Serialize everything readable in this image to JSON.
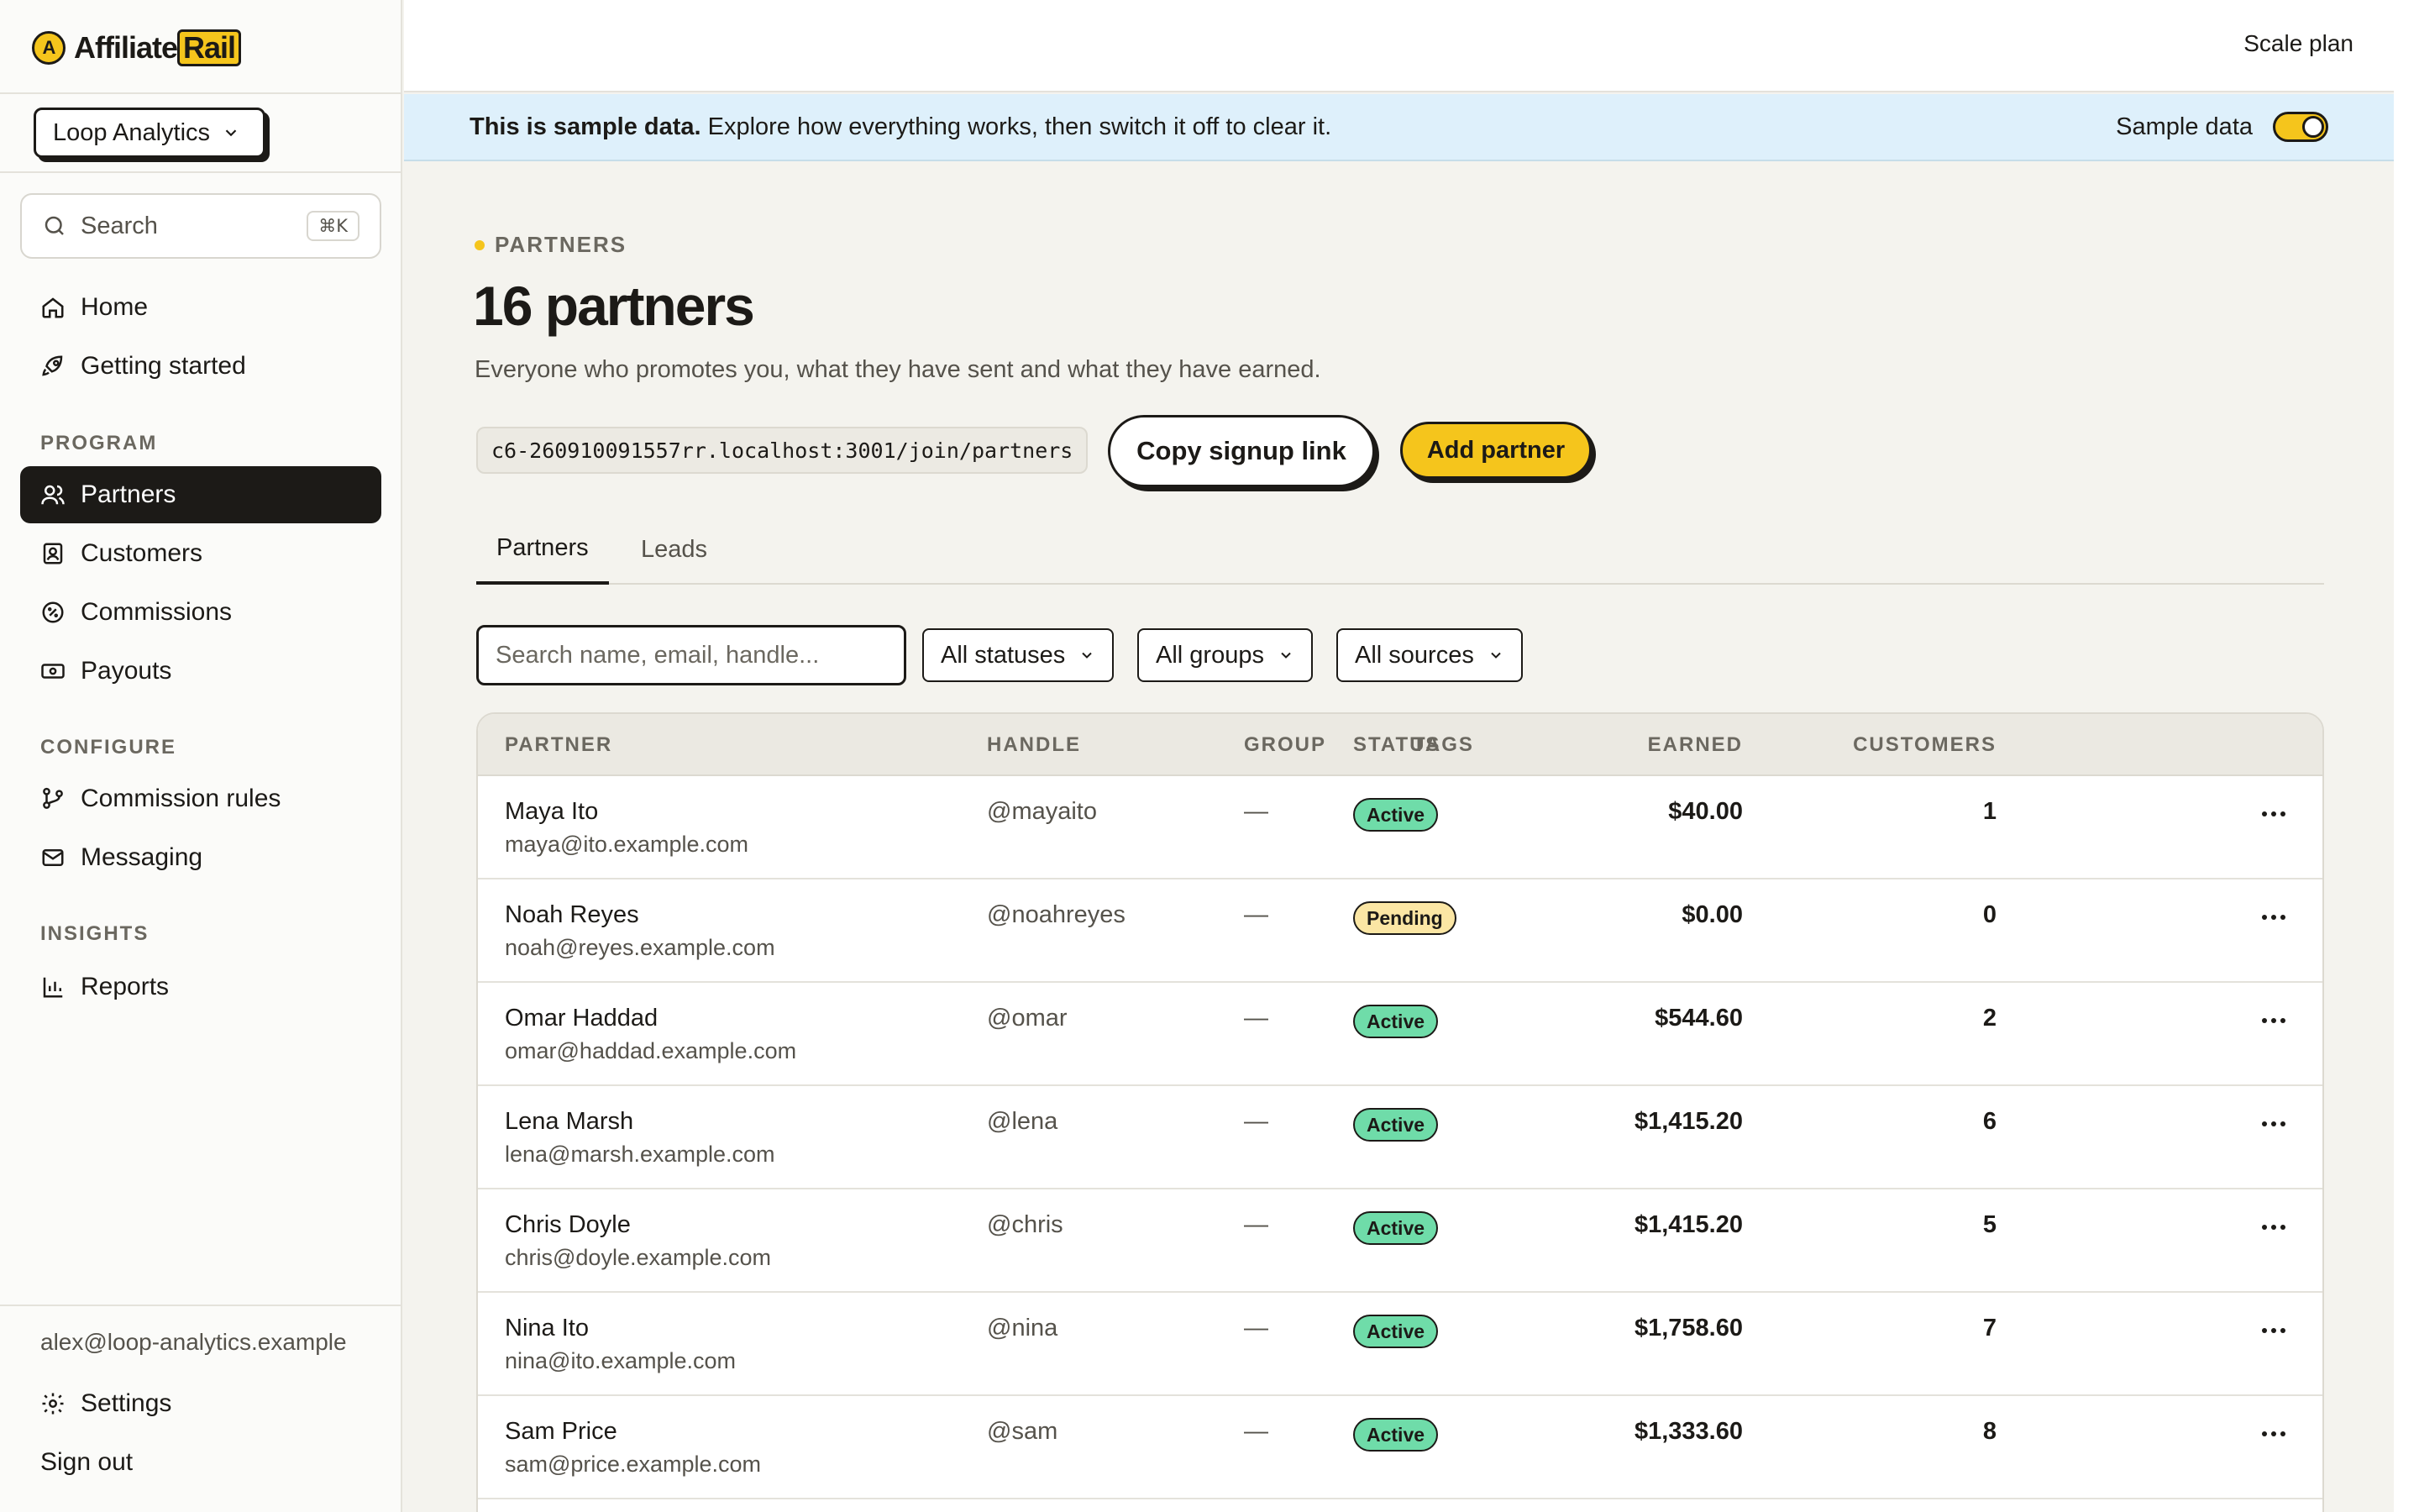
{
  "app": {
    "logo_mark": "A",
    "logo_text_1": "Affiliate",
    "logo_text_2": "Rail",
    "plan": "Scale plan"
  },
  "sidebar": {
    "org_name": "Loop Analytics",
    "search_label": "Search",
    "search_shortcut": "⌘K",
    "nav_main": [
      {
        "label": "Home",
        "icon": "home-icon"
      },
      {
        "label": "Getting started",
        "icon": "rocket-icon"
      }
    ],
    "section_program": "PROGRAM",
    "nav_program": [
      {
        "label": "Partners",
        "icon": "users-icon",
        "active": true
      },
      {
        "label": "Customers",
        "icon": "contact-icon"
      },
      {
        "label": "Commissions",
        "icon": "percent-badge-icon"
      },
      {
        "label": "Payouts",
        "icon": "banknote-icon"
      }
    ],
    "section_configure": "CONFIGURE",
    "nav_configure": [
      {
        "label": "Commission rules",
        "icon": "git-branch-icon"
      },
      {
        "label": "Messaging",
        "icon": "mail-icon"
      }
    ],
    "section_insights": "INSIGHTS",
    "nav_insights": [
      {
        "label": "Reports",
        "icon": "bar-chart-icon"
      }
    ],
    "user_email": "alex@loop-analytics.example",
    "settings_label": "Settings",
    "signout_label": "Sign out"
  },
  "banner": {
    "bold": "This is sample data.",
    "text": "Explore how everything works, then switch it off to clear it.",
    "toggle_label": "Sample data",
    "toggle_on": true
  },
  "page": {
    "eyebrow": "PARTNERS",
    "title": "16 partners",
    "subtitle": "Everyone who promotes you, what they have sent and what they have earned.",
    "signup_link": "c6-260910091557rr.localhost:3001/join/partners",
    "copy_button": "Copy signup link",
    "add_button": "Add partner"
  },
  "tabs": [
    {
      "label": "Partners",
      "active": true
    },
    {
      "label": "Leads",
      "active": false
    }
  ],
  "filters": {
    "search_placeholder": "Search name, email, handle...",
    "status": "All statuses",
    "groups": "All groups",
    "sources": "All sources"
  },
  "table": {
    "headers": {
      "partner": "PARTNER",
      "handle": "HANDLE",
      "group": "GROUP",
      "tags": "TAGS",
      "earned": "EARNED",
      "customers": "CUSTOMERS",
      "status": "STATUS"
    },
    "rows": [
      {
        "name": "Maya Ito",
        "email": "maya@ito.example.com",
        "handle": "@mayaito",
        "group": "—",
        "earned": "$40.00",
        "customers": "1",
        "status": "Active"
      },
      {
        "name": "Noah Reyes",
        "email": "noah@reyes.example.com",
        "handle": "@noahreyes",
        "group": "—",
        "earned": "$0.00",
        "customers": "0",
        "status": "Pending"
      },
      {
        "name": "Omar Haddad",
        "email": "omar@haddad.example.com",
        "handle": "@omar",
        "group": "—",
        "earned": "$544.60",
        "customers": "2",
        "status": "Active"
      },
      {
        "name": "Lena Marsh",
        "email": "lena@marsh.example.com",
        "handle": "@lena",
        "group": "—",
        "earned": "$1,415.20",
        "customers": "6",
        "status": "Active"
      },
      {
        "name": "Chris Doyle",
        "email": "chris@doyle.example.com",
        "handle": "@chris",
        "group": "—",
        "earned": "$1,415.20",
        "customers": "5",
        "status": "Active"
      },
      {
        "name": "Nina Ito",
        "email": "nina@ito.example.com",
        "handle": "@nina",
        "group": "—",
        "earned": "$1,758.60",
        "customers": "7",
        "status": "Active"
      },
      {
        "name": "Sam Price",
        "email": "sam@price.example.com",
        "handle": "@sam",
        "group": "—",
        "earned": "$1,333.60",
        "customers": "8",
        "status": "Active"
      }
    ]
  },
  "colors": {
    "accent": "#f5c51c",
    "active_badge": "#6fdca9",
    "pending_badge": "#fbe6a4",
    "banner_bg": "#def0fb",
    "nav_active_bg": "#1c1a17"
  }
}
